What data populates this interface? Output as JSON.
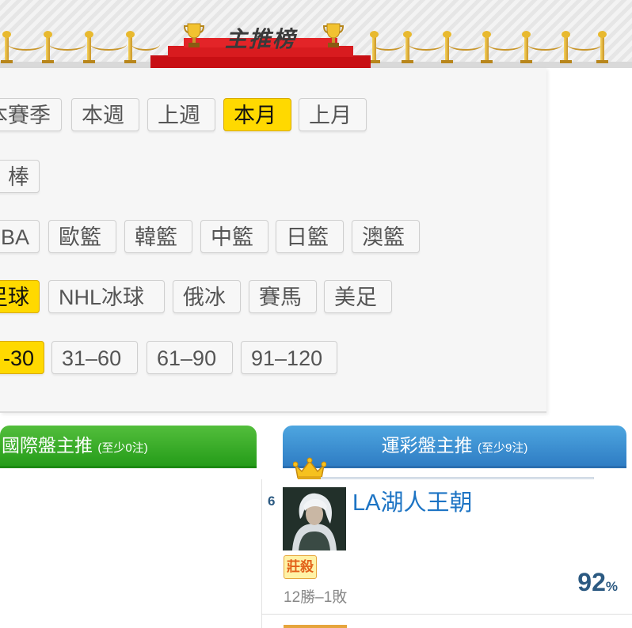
{
  "banner": {
    "title": "主推榜"
  },
  "filters": {
    "row1": [
      {
        "label": "本賽季",
        "active": false
      },
      {
        "label": "本週",
        "active": false
      },
      {
        "label": "上週",
        "active": false
      },
      {
        "label": "本月",
        "active": true
      },
      {
        "label": "上月",
        "active": false
      }
    ],
    "row2": [
      {
        "label": "棒",
        "active": false
      }
    ],
    "row3": [
      {
        "label": "BA",
        "active": false
      },
      {
        "label": "歐籃",
        "active": false
      },
      {
        "label": "韓籃",
        "active": false
      },
      {
        "label": "中籃",
        "active": false
      },
      {
        "label": "日籃",
        "active": false
      },
      {
        "label": "澳籃",
        "active": false
      }
    ],
    "row4": [
      {
        "label": "足球",
        "active": true
      },
      {
        "label": "NHL冰球",
        "active": false
      },
      {
        "label": "俄冰",
        "active": false
      },
      {
        "label": "賽馬",
        "active": false
      },
      {
        "label": "美足",
        "active": false
      }
    ],
    "row5": [
      {
        "label": "-30",
        "active": true
      },
      {
        "label": "31–60",
        "active": false
      },
      {
        "label": "61–90",
        "active": false
      },
      {
        "label": "91–120",
        "active": false
      }
    ]
  },
  "lists": {
    "international": {
      "title": "國際盤主推",
      "note": "(至少0注)"
    },
    "lottery": {
      "title": "運彩盤主推",
      "note": "(至少9注)"
    }
  },
  "entry": {
    "rank": "6",
    "name": "LA湖人王朝",
    "badge": "莊殺",
    "record": "12勝–1敗",
    "percent": "92",
    "percent_unit": "%"
  },
  "colors": {
    "active_chip": "#ffd900",
    "green_header": "#2ea321",
    "blue_header": "#3a8bd0",
    "name_blue": "#1d74c4"
  }
}
